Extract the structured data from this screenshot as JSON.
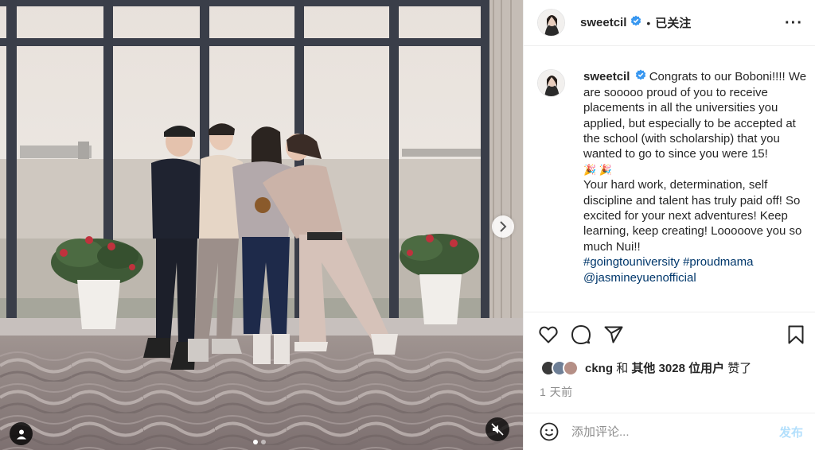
{
  "post": {
    "username": "sweetcil",
    "verified": true,
    "follow_status": "已关注",
    "more_label": "···"
  },
  "caption": {
    "username": "sweetcil",
    "body_1": "Congrats to our Boboni!!!! We are sooooo proud of you to receive placements in all the universities you applied, but especially to be accepted at the school (with scholarship) that you wanted to go to since you were 15!",
    "emoji": "🎉 🎉",
    "body_2": "Your hard work, determination, self discipline and talent has truly paid off! So excited for your next adventures! Keep learning, keep creating! Looooove you so much Nui!!",
    "hashtags": "#goingtouniversity #proudmama",
    "mention": "@jasmineyuenofficial"
  },
  "likes": {
    "first_liker": "ckng",
    "connector": "和",
    "others": "其他 3028 位用户",
    "suffix": "赞了"
  },
  "timestamp": "1 天前",
  "comment": {
    "placeholder": "添加评论...",
    "post_label": "发布"
  },
  "carousel": {
    "slide_count": 2,
    "active_index": 0
  },
  "colors": {
    "verified_blue": "#3897f0",
    "link_blue": "#00376b",
    "post_disabled": "#b2dffc",
    "muted_text": "#8e8e8e"
  },
  "icons": [
    "heart-icon",
    "comment-icon",
    "share-icon",
    "save-icon",
    "emoji-icon",
    "user-tag-icon",
    "mute-icon",
    "chevron-right-icon",
    "more-icon",
    "verified-badge-icon"
  ]
}
